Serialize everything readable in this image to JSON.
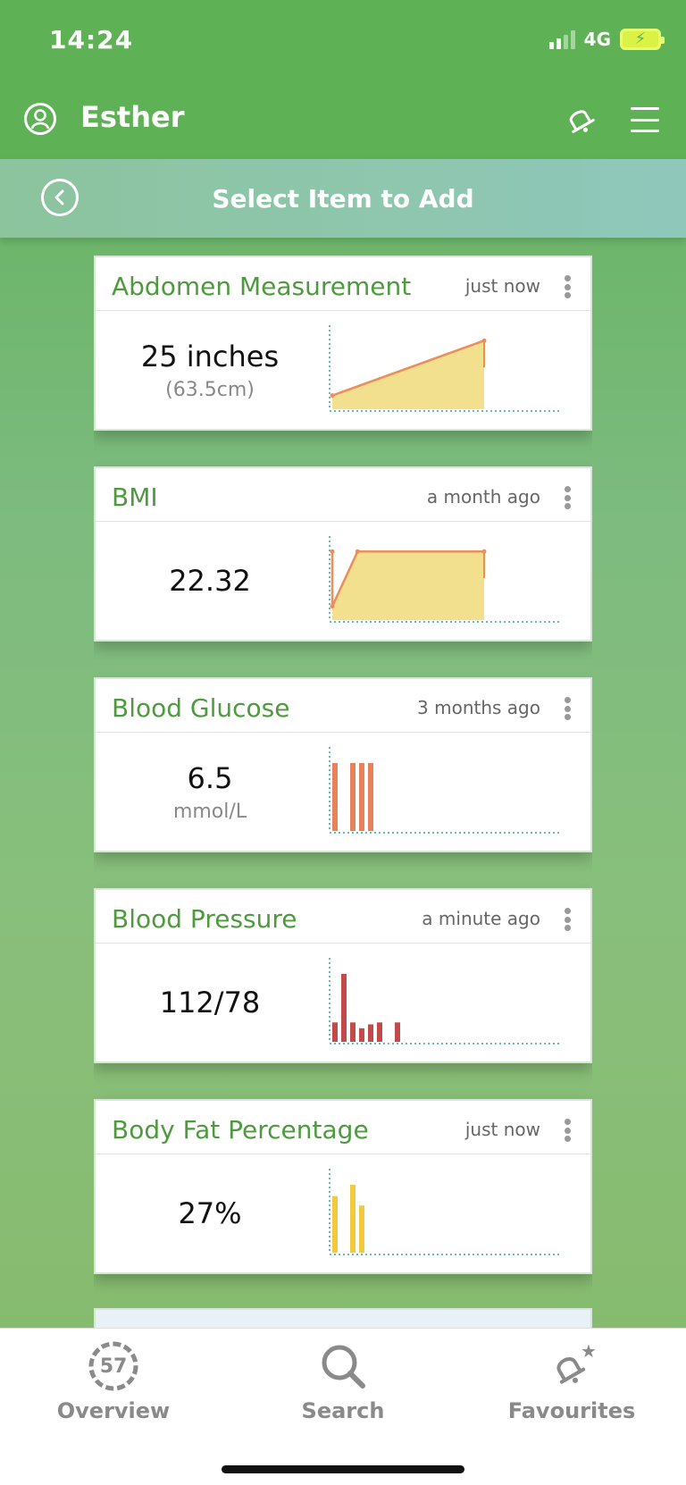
{
  "status": {
    "time": "14:24",
    "network": "4G"
  },
  "header": {
    "user_name": "Esther",
    "icons": [
      "user-circle-icon",
      "bell-icon",
      "menu-icon"
    ]
  },
  "subheader": {
    "title": "Select Item to Add",
    "back_icon": "chevron-left-icon"
  },
  "cards": [
    {
      "title": "Abdomen Measurement",
      "time": "just now",
      "value": "25 inches",
      "sub": "(63.5cm)",
      "chart_data": {
        "type": "area",
        "x": [
          0,
          1
        ],
        "values": [
          25,
          25.5
        ],
        "color": "#ec8d5a",
        "fill": "#f2e08e"
      }
    },
    {
      "title": "BMI",
      "time": "a month ago",
      "value": "22.32",
      "sub": "",
      "chart_data": {
        "type": "area",
        "x": [
          0,
          0,
          1,
          6
        ],
        "values": [
          22.3,
          21.7,
          22.3,
          22.3
        ],
        "color": "#ec8d5a",
        "fill": "#f2e08e"
      }
    },
    {
      "title": "Blood Glucose",
      "time": "3 months ago",
      "value": "6.5",
      "sub": "mmol/L",
      "chart_data": {
        "type": "bar",
        "values": [
          6.5,
          0,
          6.5,
          6.5,
          6.5
        ],
        "color": "#e8825a"
      }
    },
    {
      "title": "Blood Pressure",
      "time": "a minute ago",
      "value": "112/78",
      "sub": "",
      "chart_data": {
        "type": "bar",
        "values": [
          20,
          70,
          20,
          14,
          18,
          20,
          0,
          20
        ],
        "color": "#c24a4a"
      }
    },
    {
      "title": "Body Fat Percentage",
      "time": "just now",
      "value": "27%",
      "sub": "",
      "chart_data": {
        "type": "bar",
        "values": [
          60,
          0,
          72,
          50
        ],
        "color": "#f3c93e"
      }
    }
  ],
  "tabbar": {
    "overview_label": "Overview",
    "overview_count": "57",
    "search_label": "Search",
    "favourites_label": "Favourites"
  }
}
